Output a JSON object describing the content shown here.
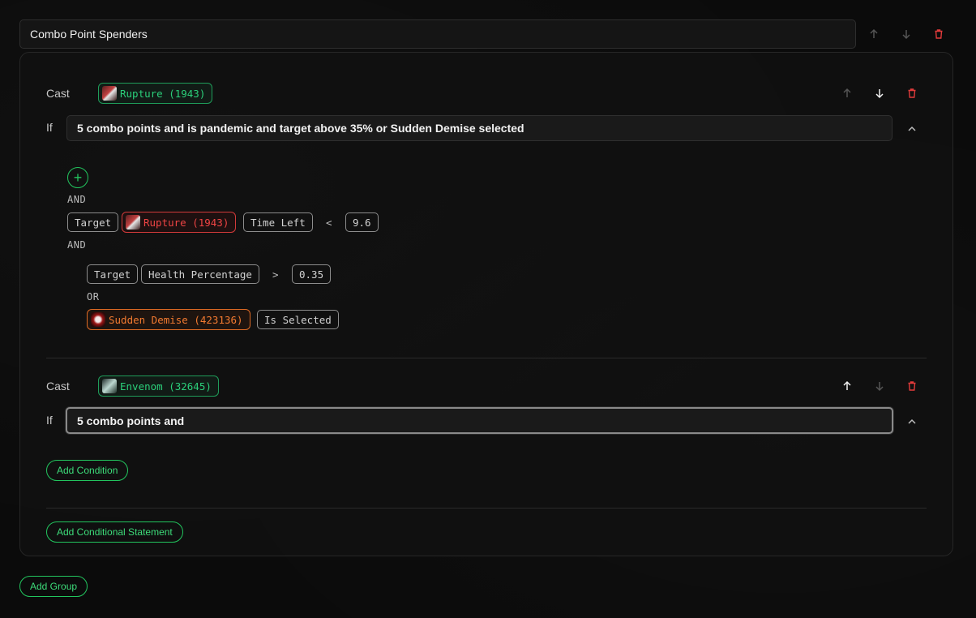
{
  "group": {
    "title": "Combo Point Spenders",
    "add_group_label": "Add Group",
    "add_statement_label": "Add Conditional Statement"
  },
  "statements": [
    {
      "cast_label": "Cast",
      "spell": "Rupture (1943)",
      "if_label": "If",
      "condition_text": "5 combo points and is pandemic and target above 35% or Sudden Demise selected",
      "plus": "+",
      "logic1": "AND",
      "row1": {
        "unit": "Target",
        "spell": "Rupture (1943)",
        "prop": "Time Left",
        "op": "<",
        "value": "9.6"
      },
      "logic2": "AND",
      "row2": {
        "unit": "Target",
        "prop": "Health Percentage",
        "op": ">",
        "value": "0.35"
      },
      "logic3": "OR",
      "row3": {
        "spell": "Sudden Demise (423136)",
        "prop": "Is Selected"
      }
    },
    {
      "cast_label": "Cast",
      "spell": "Envenom (32645)",
      "if_label": "If",
      "condition_text": "5 combo points and",
      "add_condition_label": "Add Condition"
    }
  ],
  "colors": {
    "accent_green": "#22c55e",
    "danger_red": "#ef4444",
    "spell_orange": "#f27a30"
  },
  "icons": [
    "arrow-up-icon",
    "arrow-down-icon",
    "trash-icon",
    "chevron-up-icon",
    "plus-icon"
  ]
}
